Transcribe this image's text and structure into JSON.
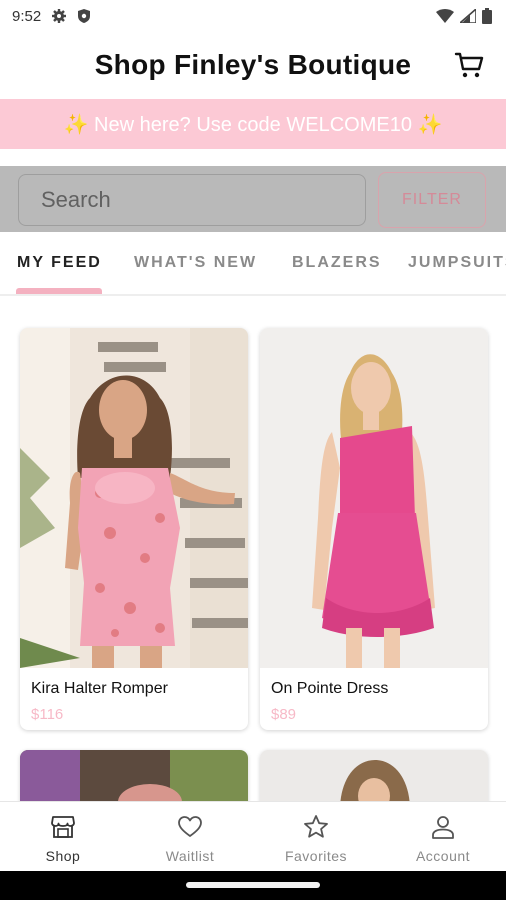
{
  "status_bar": {
    "time": "9:52",
    "icons_left": [
      "gear-icon",
      "shield-icon"
    ],
    "icons_right": [
      "wifi-icon",
      "signal-icon",
      "battery-icon"
    ]
  },
  "app_bar": {
    "title": "Shop Finley's Boutique",
    "cart_icon": "cart-icon"
  },
  "promo_banner": {
    "text": "✨ New here? Use code WELCOME10 ✨",
    "background": "#fcc9d5"
  },
  "search": {
    "placeholder": "Search",
    "filter_label": "FILTER"
  },
  "tabs": [
    {
      "label": "MY FEED",
      "active": true
    },
    {
      "label": "WHAT'S NEW",
      "active": false
    },
    {
      "label": "BLAZERS",
      "active": false
    },
    {
      "label": "JUMPSUITS",
      "active": false
    }
  ],
  "products": [
    {
      "name": "Kira Halter Romper",
      "price": "$116"
    },
    {
      "name": "On Pointe Dress",
      "price": "$89"
    }
  ],
  "bottom_nav": [
    {
      "label": "Shop",
      "icon": "storefront-icon",
      "active": true
    },
    {
      "label": "Waitlist",
      "icon": "heart-icon",
      "active": false
    },
    {
      "label": "Favorites",
      "icon": "star-icon",
      "active": false
    },
    {
      "label": "Account",
      "icon": "person-icon",
      "active": false
    }
  ],
  "colors": {
    "accent_pink": "#f4b1c0",
    "price_pink": "#f7b9c7",
    "filter_pink": "#d58a98"
  }
}
